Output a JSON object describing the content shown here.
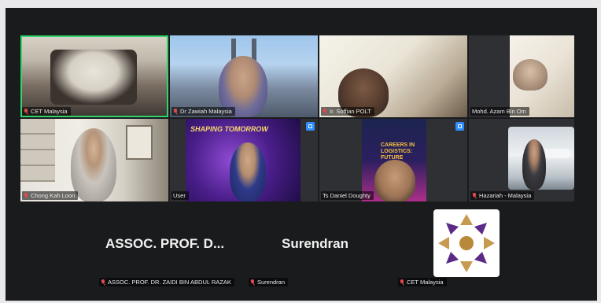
{
  "participants": {
    "cet_malaysia_video": {
      "name": "CET Malaysia"
    },
    "zawiah": {
      "name": "Dr Zawiah Malaysia"
    },
    "soffian": {
      "name": "Ir. Soffian POLT"
    },
    "azam": {
      "name": "Mohd. Azam Bin Om"
    },
    "chong": {
      "name": "Chong Kah Loon"
    },
    "user": {
      "name": "User"
    },
    "daniel": {
      "name": "Ts Daniel Doughty"
    },
    "hazariah": {
      "name": "Hazariah - Malaysia"
    },
    "zaidi": {
      "name": "ASSOC. PROF. DR. ZAIDI BIN ABDUL RAZAK",
      "display": "ASSOC. PROF. D..."
    },
    "surendran": {
      "name": "Surendran",
      "display": "Surendran"
    },
    "cet_malaysia_logo": {
      "name": "CET Malaysia"
    }
  },
  "slides": {
    "user_share_title": "SHAPING TOMORROW",
    "daniel_share_title": "CAREERS IN LOGISTICS: FUTURE"
  },
  "colors": {
    "active_speaker": "#2fd46a",
    "share_badge": "#2d8cff",
    "muted_mic": "#e24a4a",
    "meeting_bg": "#1a1b1d",
    "logo_brown": "#b8893a",
    "logo_purple": "#5b2a86"
  }
}
